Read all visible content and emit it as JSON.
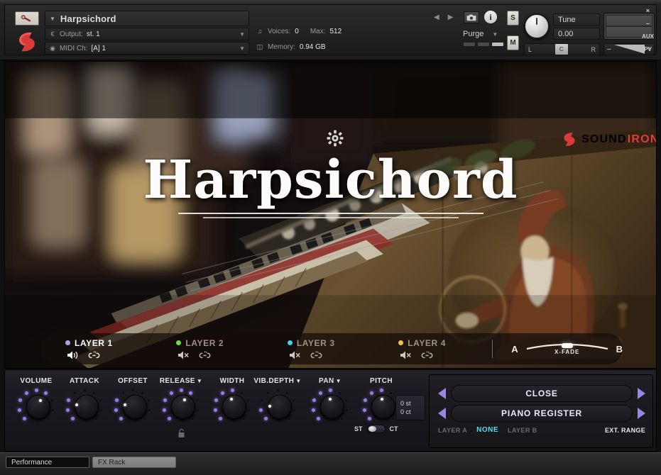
{
  "header": {
    "wrench_icon": "wrench-icon",
    "brand_mark": "soundiron-s-mark",
    "instrument_name": "Harpsichord",
    "output_label": "Output:",
    "output_value": "st. 1",
    "midi_label": "MIDI Ch:",
    "midi_value": "[A] 1",
    "voices_label": "Voices:",
    "voices_value": "0",
    "max_label": "Max:",
    "max_value": "512",
    "memory_label": "Memory:",
    "memory_value": "0.94 GB",
    "prev_icon": "prev-arrow-icon",
    "next_icon": "next-arrow-icon",
    "camera_icon": "camera-icon",
    "info_icon": "info-icon",
    "purge_label": "Purge",
    "solo_label": "S",
    "mute_label": "M",
    "tune_label": "Tune",
    "tune_value": "0.00",
    "pan_left": "L",
    "pan_center": "C",
    "pan_right": "R",
    "vol_minus": "–",
    "vol_plus": "+",
    "rail": [
      "×",
      "–",
      "AUX",
      "PV"
    ]
  },
  "art": {
    "gear_icon": "gear-icon",
    "logo_part1": "SOUND",
    "logo_part2": "IRON",
    "title": "Harpsichord"
  },
  "layers": {
    "items": [
      {
        "name": "LAYER 1",
        "color": "#b99cf0",
        "active": true,
        "speaker_icon": "speaker-on-icon",
        "link_icon": "link-icon"
      },
      {
        "name": "LAYER 2",
        "color": "#6ddc4a",
        "active": false,
        "speaker_icon": "speaker-mute-icon",
        "link_icon": "link-icon"
      },
      {
        "name": "LAYER 3",
        "color": "#4ec8f0",
        "active": false,
        "speaker_icon": "speaker-mute-icon",
        "link_icon": "link-icon"
      },
      {
        "name": "LAYER 4",
        "color": "#f0c44a",
        "active": false,
        "speaker_icon": "speaker-mute-icon",
        "link_icon": "link-icon"
      }
    ],
    "xfade_a": "A",
    "xfade_b": "B",
    "xfade_label": "X-FADE"
  },
  "controls": {
    "knobs": [
      {
        "label": "VOLUME",
        "has_menu": false,
        "value_pct": 0.62
      },
      {
        "label": "ATTACK",
        "has_menu": false,
        "value_pct": 0.22
      },
      {
        "label": "OFFSET",
        "has_menu": false,
        "value_pct": 0.22
      },
      {
        "label": "RELEASE",
        "has_menu": true,
        "value_pct": 0.6
      },
      {
        "label": "WIDTH",
        "has_menu": false,
        "value_pct": 0.48
      },
      {
        "label": "VIB.DEPTH",
        "has_menu": true,
        "value_pct": 0.18
      },
      {
        "label": "PAN",
        "has_menu": true,
        "value_pct": 0.5
      },
      {
        "label": "PITCH",
        "has_menu": false,
        "value_pct": 0.52
      }
    ],
    "menu_caret": "▼",
    "lock_icon": "lock-icon",
    "pitch_semitones": "0 st",
    "pitch_cents": "0 ct",
    "st_label": "ST",
    "ct_label": "CT"
  },
  "mic_panel": {
    "mic_position": "CLOSE",
    "register": "PIANO REGISTER",
    "layer_a": "LAYER A",
    "none": "NONE",
    "layer_b": "LAYER B",
    "ext_range": "EXT. RANGE",
    "arrow_left_icon": "arrow-left-icon",
    "arrow_right_icon": "arrow-right-icon"
  },
  "footer": {
    "tabs": [
      {
        "label": "Performance",
        "selected": true
      },
      {
        "label": "FX Rack",
        "selected": false
      }
    ]
  },
  "colors": {
    "accent_purple": "#9a86e0",
    "accent_cyan": "#56d7f2",
    "brand_red": "#e03a3a"
  }
}
